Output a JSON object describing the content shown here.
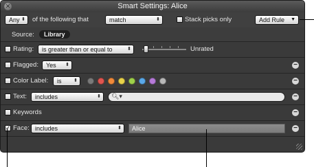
{
  "window": {
    "title": "Smart Settings: Alice"
  },
  "header": {
    "match_quantifier": "Any",
    "of_following_label": "of the following that",
    "match_mode": "match",
    "stack_picks_label": "Stack picks only",
    "add_rule_label": "Add Rule"
  },
  "source": {
    "label": "Source:",
    "value": "Library"
  },
  "rules": {
    "rating": {
      "label": "Rating:",
      "operator": "is greater than or equal to",
      "value_text": "Unrated"
    },
    "flagged": {
      "label": "Flagged:",
      "value": "Yes"
    },
    "color_label": {
      "label": "Color Label:",
      "operator": "is",
      "colors": [
        "#7a7a7a",
        "#e0554f",
        "#f08a3a",
        "#e8d24a",
        "#9ed04a",
        "#5aa8e8",
        "#b67ad8",
        "#b8b8b8"
      ]
    },
    "text": {
      "label": "Text:",
      "operator": "includes",
      "value": ""
    },
    "keywords": {
      "label": "Keywords"
    },
    "face": {
      "label": "Face:",
      "operator": "includes",
      "value": "Alice",
      "checked": true
    }
  }
}
